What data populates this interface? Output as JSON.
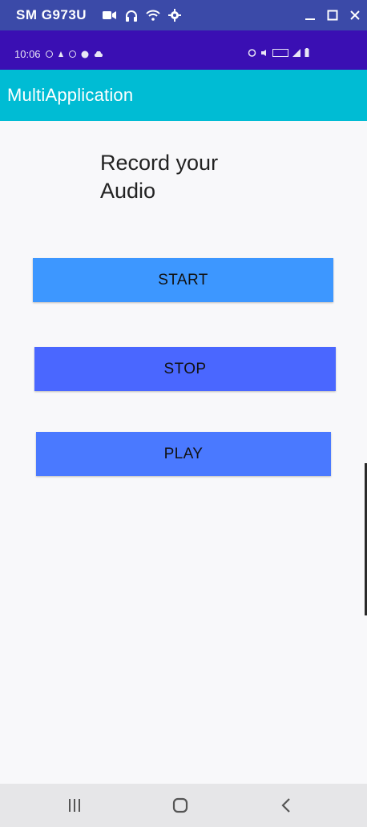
{
  "host_window": {
    "title": "SM G973U",
    "icons": [
      "video-camera-icon",
      "headphones-icon",
      "wifi-icon",
      "gear-icon"
    ],
    "controls": [
      "minimize-icon",
      "maximize-icon",
      "close-icon"
    ]
  },
  "status_bar": {
    "time": "10:06",
    "left_icons": [
      "whatsapp-icon",
      "notification-icon",
      "messenger-icon",
      "chat-icon",
      "cloud-icon"
    ],
    "right_icons": [
      "alarm-icon",
      "mute-icon",
      "wifi-calling-icon",
      "signal-icon",
      "battery-icon"
    ]
  },
  "app_bar": {
    "title": "MultiApplication"
  },
  "main": {
    "heading": "Record your Audio",
    "buttons": {
      "start": "START",
      "stop": "STOP",
      "play": "PLAY"
    }
  },
  "nav_bar": {
    "items": [
      "recent-apps-icon",
      "home-icon",
      "back-icon"
    ]
  },
  "colors": {
    "host_bar": "#3b4aa8",
    "status_bar": "#3a0fb3",
    "app_bar": "#00bcd4",
    "start_button": "#3d97ff",
    "stop_button": "#4a67ff",
    "play_button": "#4a79ff",
    "background": "#f8f8fa",
    "nav_bar": "#e6e6e8"
  }
}
